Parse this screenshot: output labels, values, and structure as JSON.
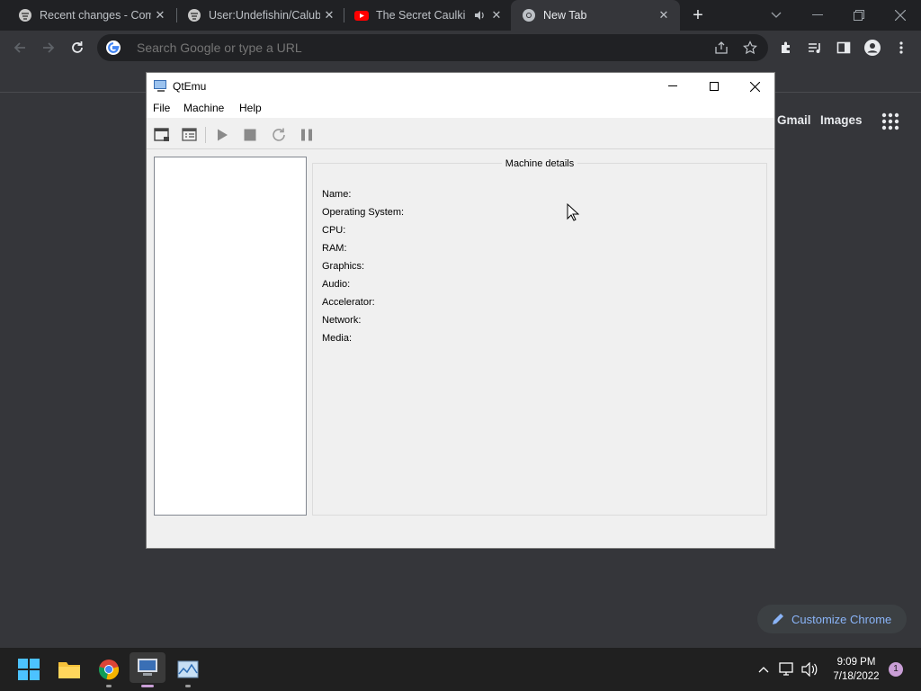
{
  "browser": {
    "tabs": [
      {
        "title": "Recent changes - Comp",
        "icon": "wiki-puzzle-icon",
        "active": false
      },
      {
        "title": "User:Undefishin/Calub",
        "icon": "wiki-puzzle-icon",
        "active": false
      },
      {
        "title": "The Secret Caulkin",
        "icon": "youtube-icon",
        "active": false,
        "audio": true
      },
      {
        "title": "New Tab",
        "icon": "chrome-icon",
        "active": true
      }
    ],
    "omnibox": {
      "placeholder": "Search Google or type a URL"
    },
    "ntp": {
      "gmail": "Gmail",
      "images": "Images",
      "customize": "Customize Chrome"
    }
  },
  "qtemu": {
    "title": "QtEmu",
    "menu": [
      "File",
      "Machine",
      "Help"
    ],
    "toolbar": [
      "machine-window-icon",
      "machine-list-icon",
      "play-icon",
      "stop-icon",
      "reset-icon",
      "pause-icon"
    ],
    "details": {
      "title": "Machine details",
      "fields": [
        "Name:",
        "Operating System:",
        "CPU:",
        "RAM:",
        "Graphics:",
        "Audio:",
        "Accelerator:",
        "Network:",
        "Media:"
      ]
    }
  },
  "taskbar": {
    "time": "9:09 PM",
    "date": "7/18/2022",
    "notifications": "1"
  },
  "colors": {
    "chrome_bg": "#35363a",
    "tabstrip": "#202124",
    "link": "#8ab4f8",
    "qt_bg": "#f0f0f0",
    "taskbar": "#202020"
  }
}
